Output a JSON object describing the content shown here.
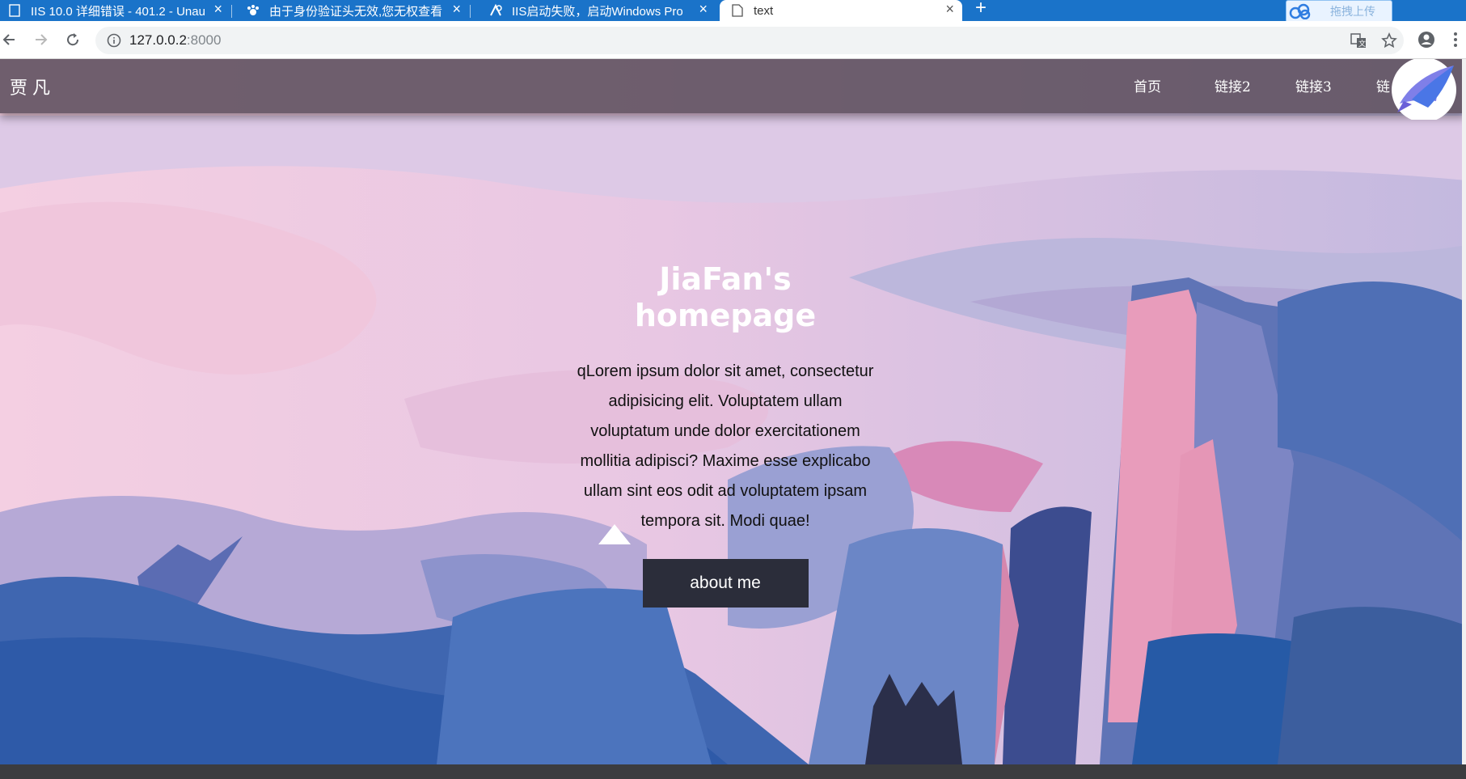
{
  "browser": {
    "tabs": [
      {
        "title": "IIS 10.0 详细错误 - 401.2 - Unau"
      },
      {
        "title": "由于身份验证头无效,您无权查看"
      },
      {
        "title": "IIS启动失败，启动Windows Pro"
      },
      {
        "title": "text"
      }
    ],
    "new_tab": "+",
    "upload_label": "拖拽上传",
    "url_host": "127.0.0.2",
    "url_port": ":8000"
  },
  "page": {
    "brand": "贾凡",
    "nav": [
      "首页",
      "链接2",
      "链接3",
      "链"
    ],
    "hero_title_line1": "JiaFan's",
    "hero_title_line2": "homepage",
    "hero_text": "qLorem ipsum dolor sit amet, consectetur adipisicing elit. Voluptatem ullam voluptatum unde dolor exercitationem mollitia adipisci? Maxime esse explicabo ullam sint eos odit ad voluptatem ipsam tempora sit. Modi quae!",
    "button_label": "about me"
  },
  "colors": {
    "tab_strip": "#1a73c9",
    "navbar": "#5c4e5c",
    "button": "#2b2d3a"
  }
}
